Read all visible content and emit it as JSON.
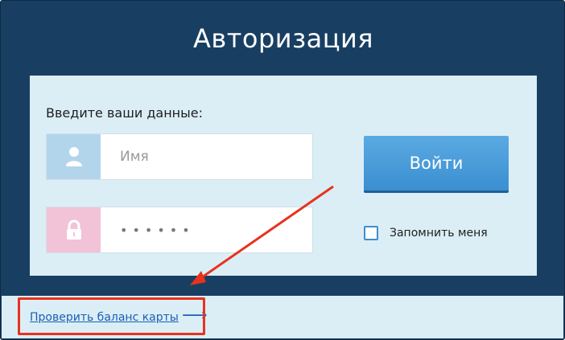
{
  "header": {
    "title": "Авторизация"
  },
  "form": {
    "prompt": "Введите ваши данные:",
    "username": {
      "placeholder": "Имя",
      "icon": "user-icon"
    },
    "password": {
      "value_masked": "••••••",
      "icon": "lock-icon"
    },
    "login_label": "Войти",
    "remember_label": "Запомнить меня"
  },
  "footer": {
    "balance_link": "Проверить баланс карты",
    "balance_arrow": "⟶"
  },
  "colors": {
    "background": "#183f62",
    "panel": "#dbeef6",
    "accent": "#3b8fd0",
    "annotation": "#e8321e"
  }
}
